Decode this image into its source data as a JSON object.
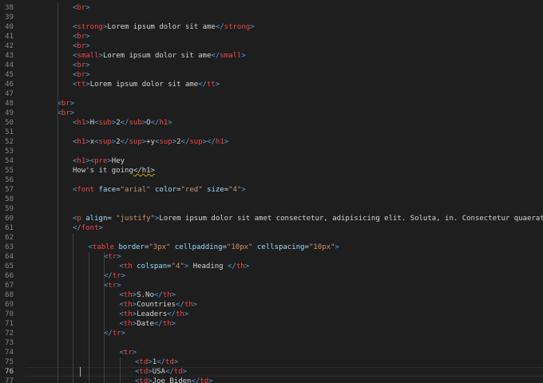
{
  "editor": {
    "theme": {
      "background": "#1e1e1e",
      "line_number": "#858585",
      "line_number_active": "#c6c6c6",
      "tag_bracket": "#569cd6",
      "tag_name": "#f44747",
      "attribute": "#9cdcfe",
      "string": "#ce9178",
      "text": "#d4d4d4"
    },
    "active_line": 76,
    "lines": [
      {
        "n": "38",
        "indent": 2,
        "tokens": [
          [
            "tag",
            "<"
          ],
          [
            "name",
            "br"
          ],
          [
            "tag",
            ">"
          ]
        ]
      },
      {
        "n": "39",
        "indent": 0,
        "tokens": []
      },
      {
        "n": "40",
        "indent": 2,
        "tokens": [
          [
            "tag",
            "<"
          ],
          [
            "name",
            "strong"
          ],
          [
            "tag",
            ">"
          ],
          [
            "text",
            "Lorem ipsum dolor sit ame"
          ],
          [
            "tag",
            "</"
          ],
          [
            "name",
            "strong"
          ],
          [
            "tag",
            ">"
          ]
        ]
      },
      {
        "n": "41",
        "indent": 2,
        "tokens": [
          [
            "tag",
            "<"
          ],
          [
            "name",
            "br"
          ],
          [
            "tag",
            ">"
          ]
        ]
      },
      {
        "n": "42",
        "indent": 2,
        "tokens": [
          [
            "tag",
            "<"
          ],
          [
            "name",
            "br"
          ],
          [
            "tag",
            ">"
          ]
        ]
      },
      {
        "n": "43",
        "indent": 2,
        "tokens": [
          [
            "tag",
            "<"
          ],
          [
            "name",
            "small"
          ],
          [
            "tag",
            ">"
          ],
          [
            "text",
            "Lorem ipsum dolor sit ame"
          ],
          [
            "tag",
            "</"
          ],
          [
            "name",
            "small"
          ],
          [
            "tag",
            ">"
          ]
        ]
      },
      {
        "n": "44",
        "indent": 2,
        "tokens": [
          [
            "tag",
            "<"
          ],
          [
            "name",
            "br"
          ],
          [
            "tag",
            ">"
          ]
        ]
      },
      {
        "n": "45",
        "indent": 2,
        "tokens": [
          [
            "tag",
            "<"
          ],
          [
            "name",
            "br"
          ],
          [
            "tag",
            ">"
          ]
        ]
      },
      {
        "n": "46",
        "indent": 2,
        "tokens": [
          [
            "tag",
            "<"
          ],
          [
            "name",
            "tt"
          ],
          [
            "tag",
            ">"
          ],
          [
            "text",
            "Lorem ipsum dolor sit ame"
          ],
          [
            "tag",
            "</"
          ],
          [
            "name",
            "tt"
          ],
          [
            "tag",
            ">"
          ]
        ]
      },
      {
        "n": "47",
        "indent": 0,
        "tokens": []
      },
      {
        "n": "48",
        "indent": 1,
        "tokens": [
          [
            "tag",
            "<"
          ],
          [
            "name",
            "br"
          ],
          [
            "tag",
            ">"
          ]
        ]
      },
      {
        "n": "49",
        "indent": 1,
        "tokens": [
          [
            "tag",
            "<"
          ],
          [
            "name",
            "br"
          ],
          [
            "tag",
            ">"
          ]
        ]
      },
      {
        "n": "50",
        "indent": 2,
        "tokens": [
          [
            "tag",
            "<"
          ],
          [
            "name",
            "h1"
          ],
          [
            "tag",
            ">"
          ],
          [
            "text",
            "H"
          ],
          [
            "tag",
            "<"
          ],
          [
            "name",
            "sub"
          ],
          [
            "tag",
            ">"
          ],
          [
            "text",
            "2"
          ],
          [
            "tag",
            "</"
          ],
          [
            "name",
            "sub"
          ],
          [
            "tag",
            ">"
          ],
          [
            "text",
            "O"
          ],
          [
            "tag",
            "</"
          ],
          [
            "name",
            "h1"
          ],
          [
            "tag",
            ">"
          ]
        ]
      },
      {
        "n": "51",
        "indent": 0,
        "tokens": []
      },
      {
        "n": "52",
        "indent": 2,
        "tokens": [
          [
            "tag",
            "<"
          ],
          [
            "name",
            "h1"
          ],
          [
            "tag",
            ">"
          ],
          [
            "text",
            "x"
          ],
          [
            "tag",
            "<"
          ],
          [
            "name",
            "sup"
          ],
          [
            "tag",
            ">"
          ],
          [
            "text",
            "2"
          ],
          [
            "tag",
            "</"
          ],
          [
            "name",
            "sup"
          ],
          [
            "tag",
            ">"
          ],
          [
            "text",
            "+y"
          ],
          [
            "tag",
            "<"
          ],
          [
            "name",
            "sup"
          ],
          [
            "tag",
            ">"
          ],
          [
            "text",
            "2"
          ],
          [
            "tag",
            "</"
          ],
          [
            "name",
            "sup"
          ],
          [
            "tag",
            ">"
          ],
          [
            "tag",
            "</"
          ],
          [
            "name",
            "h1"
          ],
          [
            "tag",
            ">"
          ]
        ]
      },
      {
        "n": "53",
        "indent": 0,
        "tokens": []
      },
      {
        "n": "54",
        "indent": 2,
        "tokens": [
          [
            "tag",
            "<"
          ],
          [
            "name",
            "h1"
          ],
          [
            "tag",
            ">"
          ],
          [
            "tag",
            "<"
          ],
          [
            "name",
            "pre"
          ],
          [
            "tag",
            ">"
          ],
          [
            "text",
            "Hey"
          ]
        ]
      },
      {
        "n": "55",
        "indent": 2,
        "tokens": [
          [
            "text",
            "How's it going"
          ],
          [
            "warn",
            "</h1>"
          ]
        ]
      },
      {
        "n": "56",
        "indent": 0,
        "tokens": []
      },
      {
        "n": "57",
        "indent": 2,
        "tokens": [
          [
            "tag",
            "<"
          ],
          [
            "name",
            "font"
          ],
          [
            "text",
            " "
          ],
          [
            "attr",
            "face"
          ],
          [
            "text",
            "="
          ],
          [
            "str",
            "\"arial\""
          ],
          [
            "text",
            " "
          ],
          [
            "attr",
            "color"
          ],
          [
            "text",
            "="
          ],
          [
            "str",
            "\"red\""
          ],
          [
            "text",
            " "
          ],
          [
            "attr",
            "size"
          ],
          [
            "text",
            "="
          ],
          [
            "str",
            "\"4\""
          ],
          [
            "tag",
            ">"
          ]
        ]
      },
      {
        "n": "58",
        "indent": 0,
        "tokens": []
      },
      {
        "n": "59",
        "indent": 0,
        "tokens": []
      },
      {
        "n": "60",
        "indent": 2,
        "tokens": [
          [
            "tag",
            "<"
          ],
          [
            "name",
            "p"
          ],
          [
            "text",
            " "
          ],
          [
            "attr",
            "align"
          ],
          [
            "text",
            "= "
          ],
          [
            "str",
            "\"justify\""
          ],
          [
            "tag",
            ">"
          ],
          [
            "text",
            "Lorem ipsum dolor sit amet consectetur, adipisicing elit. Soluta, in. Consectetur quaerat numquam aliquid"
          ]
        ]
      },
      {
        "n": "61",
        "indent": 2,
        "tokens": [
          [
            "tag",
            "</"
          ],
          [
            "name",
            "font"
          ],
          [
            "tag",
            ">"
          ]
        ]
      },
      {
        "n": "62",
        "indent": 0,
        "tokens": []
      },
      {
        "n": "63",
        "indent": 3,
        "tokens": [
          [
            "tag",
            "<"
          ],
          [
            "name",
            "table"
          ],
          [
            "text",
            " "
          ],
          [
            "attr",
            "border"
          ],
          [
            "text",
            "="
          ],
          [
            "str",
            "\"3px\""
          ],
          [
            "text",
            " "
          ],
          [
            "attr",
            "cellpadding"
          ],
          [
            "text",
            "="
          ],
          [
            "str",
            "\"10px\""
          ],
          [
            "text",
            " "
          ],
          [
            "attr",
            "cellspacing"
          ],
          [
            "text",
            "="
          ],
          [
            "str",
            "\"10px\""
          ],
          [
            "tag",
            ">"
          ]
        ]
      },
      {
        "n": "64",
        "indent": 4,
        "tokens": [
          [
            "tag",
            "<"
          ],
          [
            "name",
            "tr"
          ],
          [
            "tag",
            ">"
          ]
        ]
      },
      {
        "n": "65",
        "indent": 5,
        "tokens": [
          [
            "tag",
            "<"
          ],
          [
            "name",
            "th"
          ],
          [
            "text",
            " "
          ],
          [
            "attr",
            "colspan"
          ],
          [
            "text",
            "="
          ],
          [
            "str",
            "\"4\""
          ],
          [
            "tag",
            ">"
          ],
          [
            "text",
            " Heading "
          ],
          [
            "tag",
            "</"
          ],
          [
            "name",
            "th"
          ],
          [
            "tag",
            ">"
          ]
        ]
      },
      {
        "n": "66",
        "indent": 4,
        "tokens": [
          [
            "tag",
            "</"
          ],
          [
            "name",
            "tr"
          ],
          [
            "tag",
            ">"
          ]
        ]
      },
      {
        "n": "67",
        "indent": 4,
        "tokens": [
          [
            "tag",
            "<"
          ],
          [
            "name",
            "tr"
          ],
          [
            "tag",
            ">"
          ]
        ]
      },
      {
        "n": "68",
        "indent": 5,
        "tokens": [
          [
            "tag",
            "<"
          ],
          [
            "name",
            "th"
          ],
          [
            "tag",
            ">"
          ],
          [
            "text",
            "S.No"
          ],
          [
            "tag",
            "</"
          ],
          [
            "name",
            "th"
          ],
          [
            "tag",
            ">"
          ]
        ]
      },
      {
        "n": "69",
        "indent": 5,
        "tokens": [
          [
            "tag",
            "<"
          ],
          [
            "name",
            "th"
          ],
          [
            "tag",
            ">"
          ],
          [
            "text",
            "Countries"
          ],
          [
            "tag",
            "</"
          ],
          [
            "name",
            "th"
          ],
          [
            "tag",
            ">"
          ]
        ]
      },
      {
        "n": "70",
        "indent": 5,
        "tokens": [
          [
            "tag",
            "<"
          ],
          [
            "name",
            "th"
          ],
          [
            "tag",
            ">"
          ],
          [
            "text",
            "Leaders"
          ],
          [
            "tag",
            "</"
          ],
          [
            "name",
            "th"
          ],
          [
            "tag",
            ">"
          ]
        ]
      },
      {
        "n": "71",
        "indent": 5,
        "tokens": [
          [
            "tag",
            "<"
          ],
          [
            "name",
            "th"
          ],
          [
            "tag",
            ">"
          ],
          [
            "text",
            "Date"
          ],
          [
            "tag",
            "</"
          ],
          [
            "name",
            "th"
          ],
          [
            "tag",
            ">"
          ]
        ]
      },
      {
        "n": "72",
        "indent": 4,
        "tokens": [
          [
            "tag",
            "</"
          ],
          [
            "name",
            "tr"
          ],
          [
            "tag",
            ">"
          ]
        ]
      },
      {
        "n": "73",
        "indent": 0,
        "tokens": []
      },
      {
        "n": "74",
        "indent": 5,
        "tokens": [
          [
            "tag",
            "<"
          ],
          [
            "name",
            "tr"
          ],
          [
            "tag",
            ">"
          ]
        ]
      },
      {
        "n": "75",
        "indent": 6,
        "tokens": [
          [
            "tag",
            "<"
          ],
          [
            "name",
            "td"
          ],
          [
            "tag",
            ">"
          ],
          [
            "text",
            "1"
          ],
          [
            "tag",
            "</"
          ],
          [
            "name",
            "td"
          ],
          [
            "tag",
            ">"
          ]
        ]
      },
      {
        "n": "76",
        "indent": 6,
        "tokens": [
          [
            "tag",
            "<"
          ],
          [
            "name",
            "td"
          ],
          [
            "tag",
            ">"
          ],
          [
            "text",
            "USA"
          ],
          [
            "tag",
            "</"
          ],
          [
            "name",
            "td"
          ],
          [
            "tag",
            ">"
          ]
        ]
      },
      {
        "n": "77",
        "indent": 6,
        "tokens": [
          [
            "tag",
            "<"
          ],
          [
            "name",
            "td"
          ],
          [
            "tag",
            ">"
          ],
          [
            "text",
            "Joe Biden"
          ],
          [
            "tag",
            "</"
          ],
          [
            "name",
            "td"
          ],
          [
            "tag",
            ">"
          ]
        ]
      }
    ]
  }
}
